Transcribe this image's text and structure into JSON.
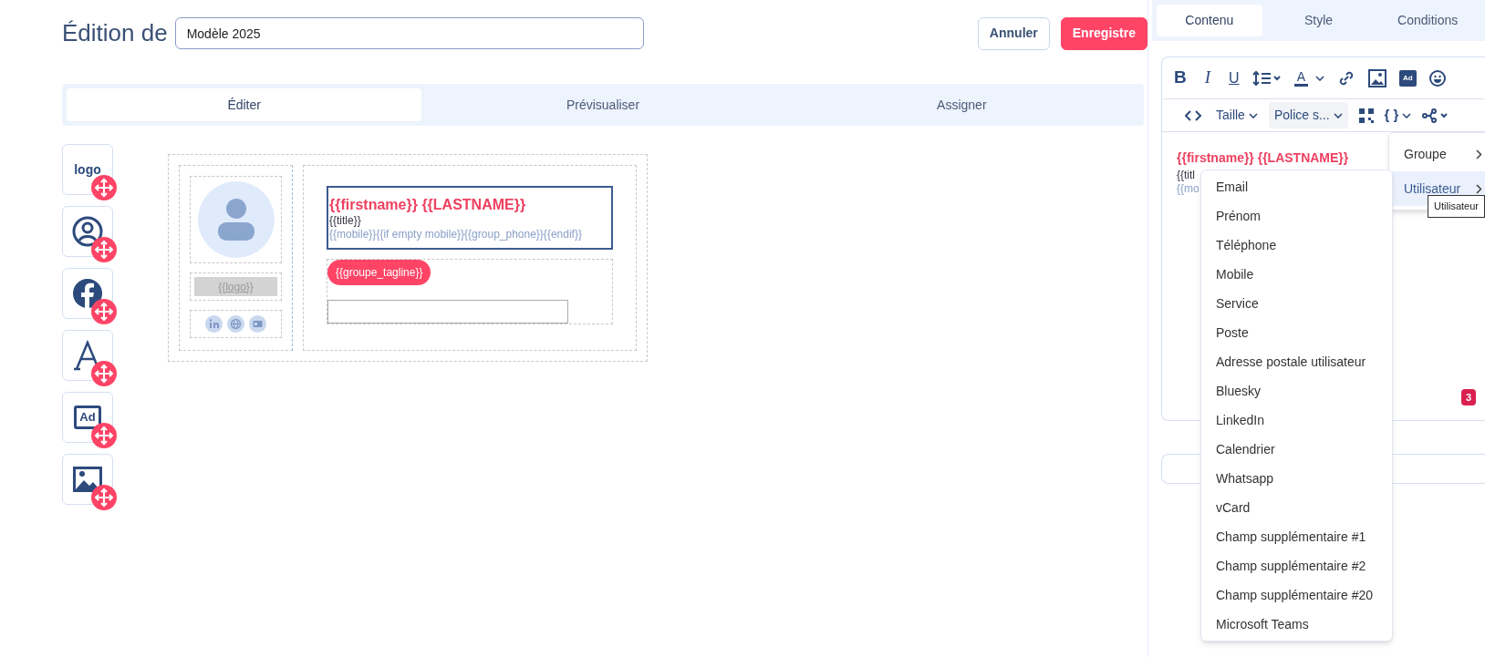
{
  "header": {
    "title": "Édition de",
    "name_field": {
      "value": "Modèle 2025"
    },
    "buttons": [
      {
        "label": "Annuler",
        "kind": "secondary"
      },
      {
        "label": "Enregistre",
        "kind": "primary"
      }
    ]
  },
  "main_tabs": [
    {
      "label": "Éditer",
      "selected": true
    },
    {
      "label": "Prévisualiser",
      "selected": false
    },
    {
      "label": "Assigner",
      "selected": false
    }
  ],
  "blocks": [
    {
      "kind": "logo",
      "label": "logo"
    },
    {
      "kind": "avatar"
    },
    {
      "kind": "facebook"
    },
    {
      "kind": "text"
    },
    {
      "kind": "ad",
      "label": "Ad"
    },
    {
      "kind": "image"
    }
  ],
  "signature": {
    "logo_placeholder": "{{logo}}",
    "name_line": "{{firstname}} {{LASTNAME}}",
    "title_line": "{{title}}",
    "phone_line": "{{mobile}}{{if empty mobile}}{{group_phone}}{{endif}}",
    "tagline": "{{groupe_tagline}}"
  },
  "panel": {
    "tabs": [
      {
        "label": "Contenu",
        "selected": true
      },
      {
        "label": "Style",
        "selected": false
      },
      {
        "label": "Conditions",
        "selected": false
      }
    ],
    "toolbar": {
      "bold": "B",
      "italic": "I",
      "underline": "U",
      "text_color": "A",
      "ad": "Ad",
      "variables": "{ }",
      "size_select": "Taille",
      "font_select": "Police s..."
    },
    "editor_lines": [
      "{{firstname}} {{LASTNAME}}",
      "{{titl",
      "{{mo"
    ],
    "badge": "3",
    "variable_menu": [
      {
        "label": "Groupe",
        "selected": false
      },
      {
        "label": "Utilisateur",
        "selected": true
      }
    ],
    "tooltip": "Utilisateur",
    "user_fields": [
      "Email",
      "Prénom",
      "Téléphone",
      "Mobile",
      "Service",
      "Poste",
      "Adresse postale utilisateur",
      "Bluesky",
      "LinkedIn",
      "Calendrier",
      "Whatsapp",
      "vCard",
      "Champ supplémentaire #1",
      "Champ supplémentaire #2",
      "Champ supplémentaire #20",
      "Microsoft Teams"
    ]
  }
}
